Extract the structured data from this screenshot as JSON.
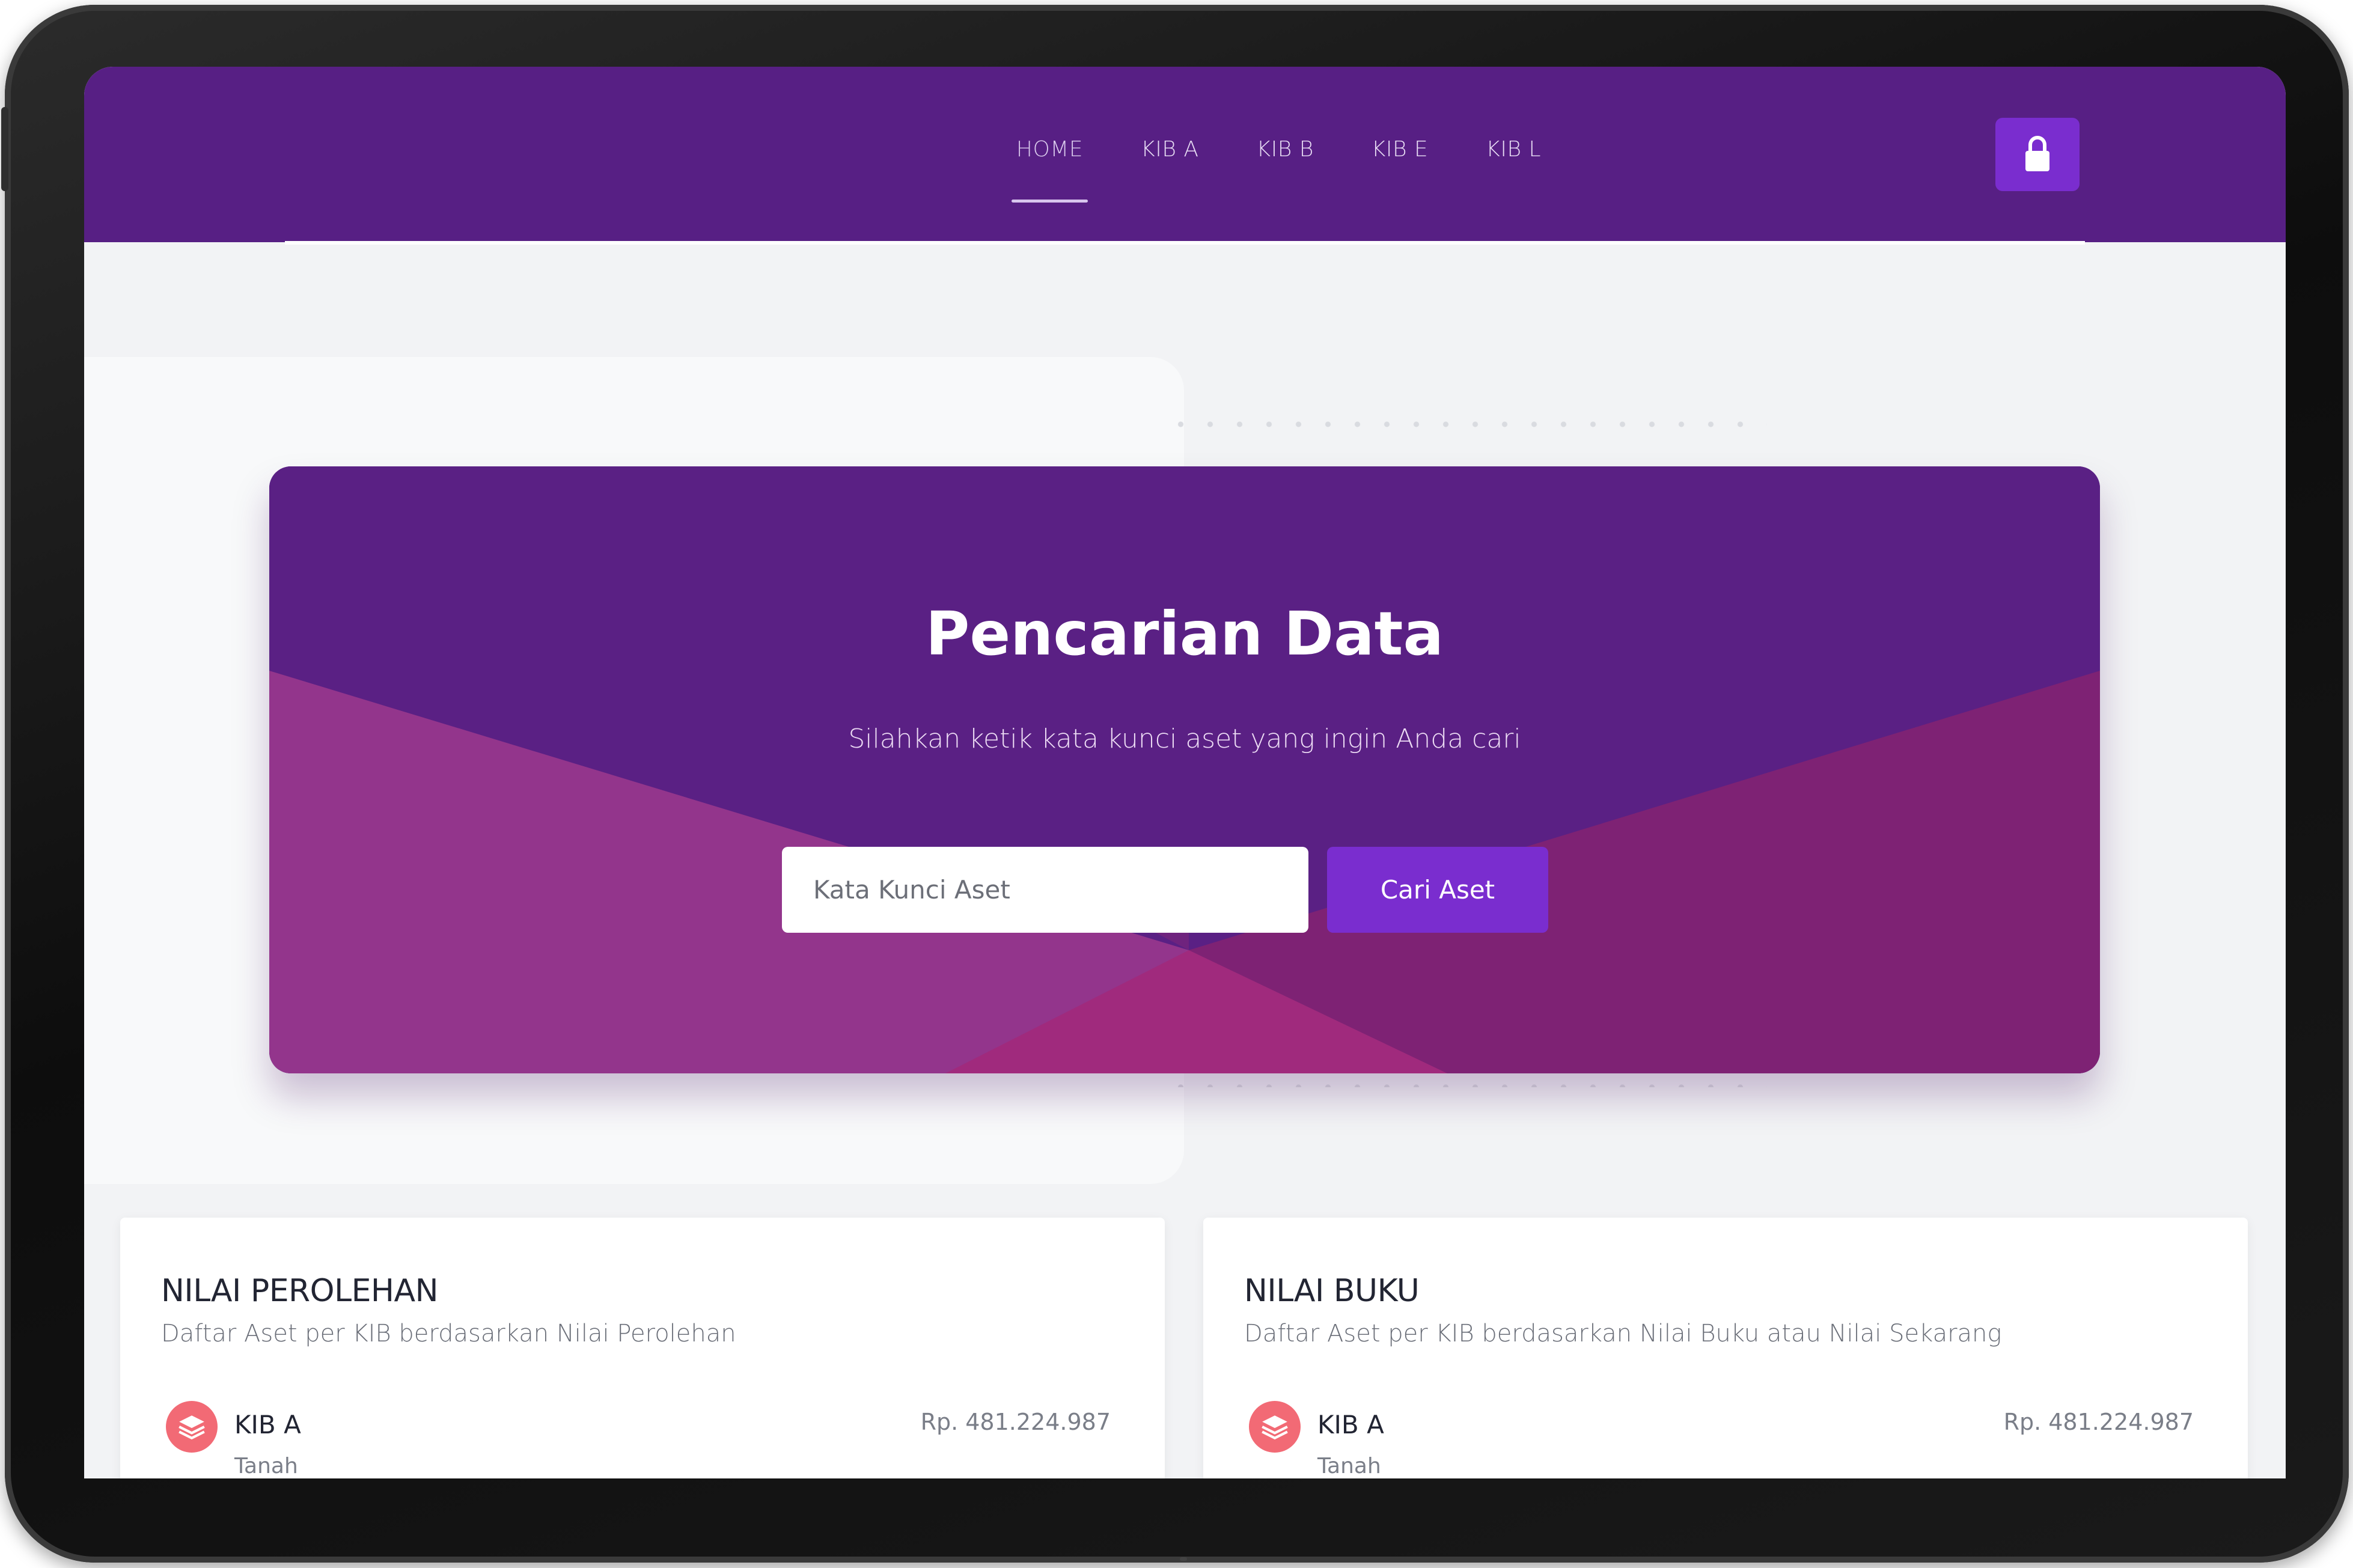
{
  "navbar": {
    "items": [
      {
        "label": "HOME",
        "active": true
      },
      {
        "label": "KIB A"
      },
      {
        "label": "KIB B"
      },
      {
        "label": "KIB E"
      },
      {
        "label": "KIB L"
      }
    ],
    "lock_icon": "lock-icon"
  },
  "hero": {
    "title": "Pencarian Data",
    "subtitle": "Silahkan ketik kata kunci aset yang ingin Anda cari",
    "search_placeholder": "Kata Kunci Aset",
    "search_value": "",
    "search_button": "Cari Aset"
  },
  "cards": [
    {
      "title": "NILAI PEROLEHAN",
      "description": "Daftar Aset per KIB berdasarkan Nilai Perolehan",
      "item": {
        "icon": "layers-icon",
        "name": "KIB A",
        "sub": "Tanah",
        "value": "Rp. 481.224.987"
      }
    },
    {
      "title": "NILAI BUKU",
      "description": "Daftar Aset per KIB berdasarkan Nilai Buku atau Nilai Sekarang",
      "item": {
        "icon": "layers-icon",
        "name": "KIB A",
        "sub": "Tanah",
        "value": "Rp. 481.224.987"
      }
    }
  ],
  "colors": {
    "primary": "#571f84",
    "accent": "#7a2dcf",
    "icon_bg": "#f26a75"
  }
}
